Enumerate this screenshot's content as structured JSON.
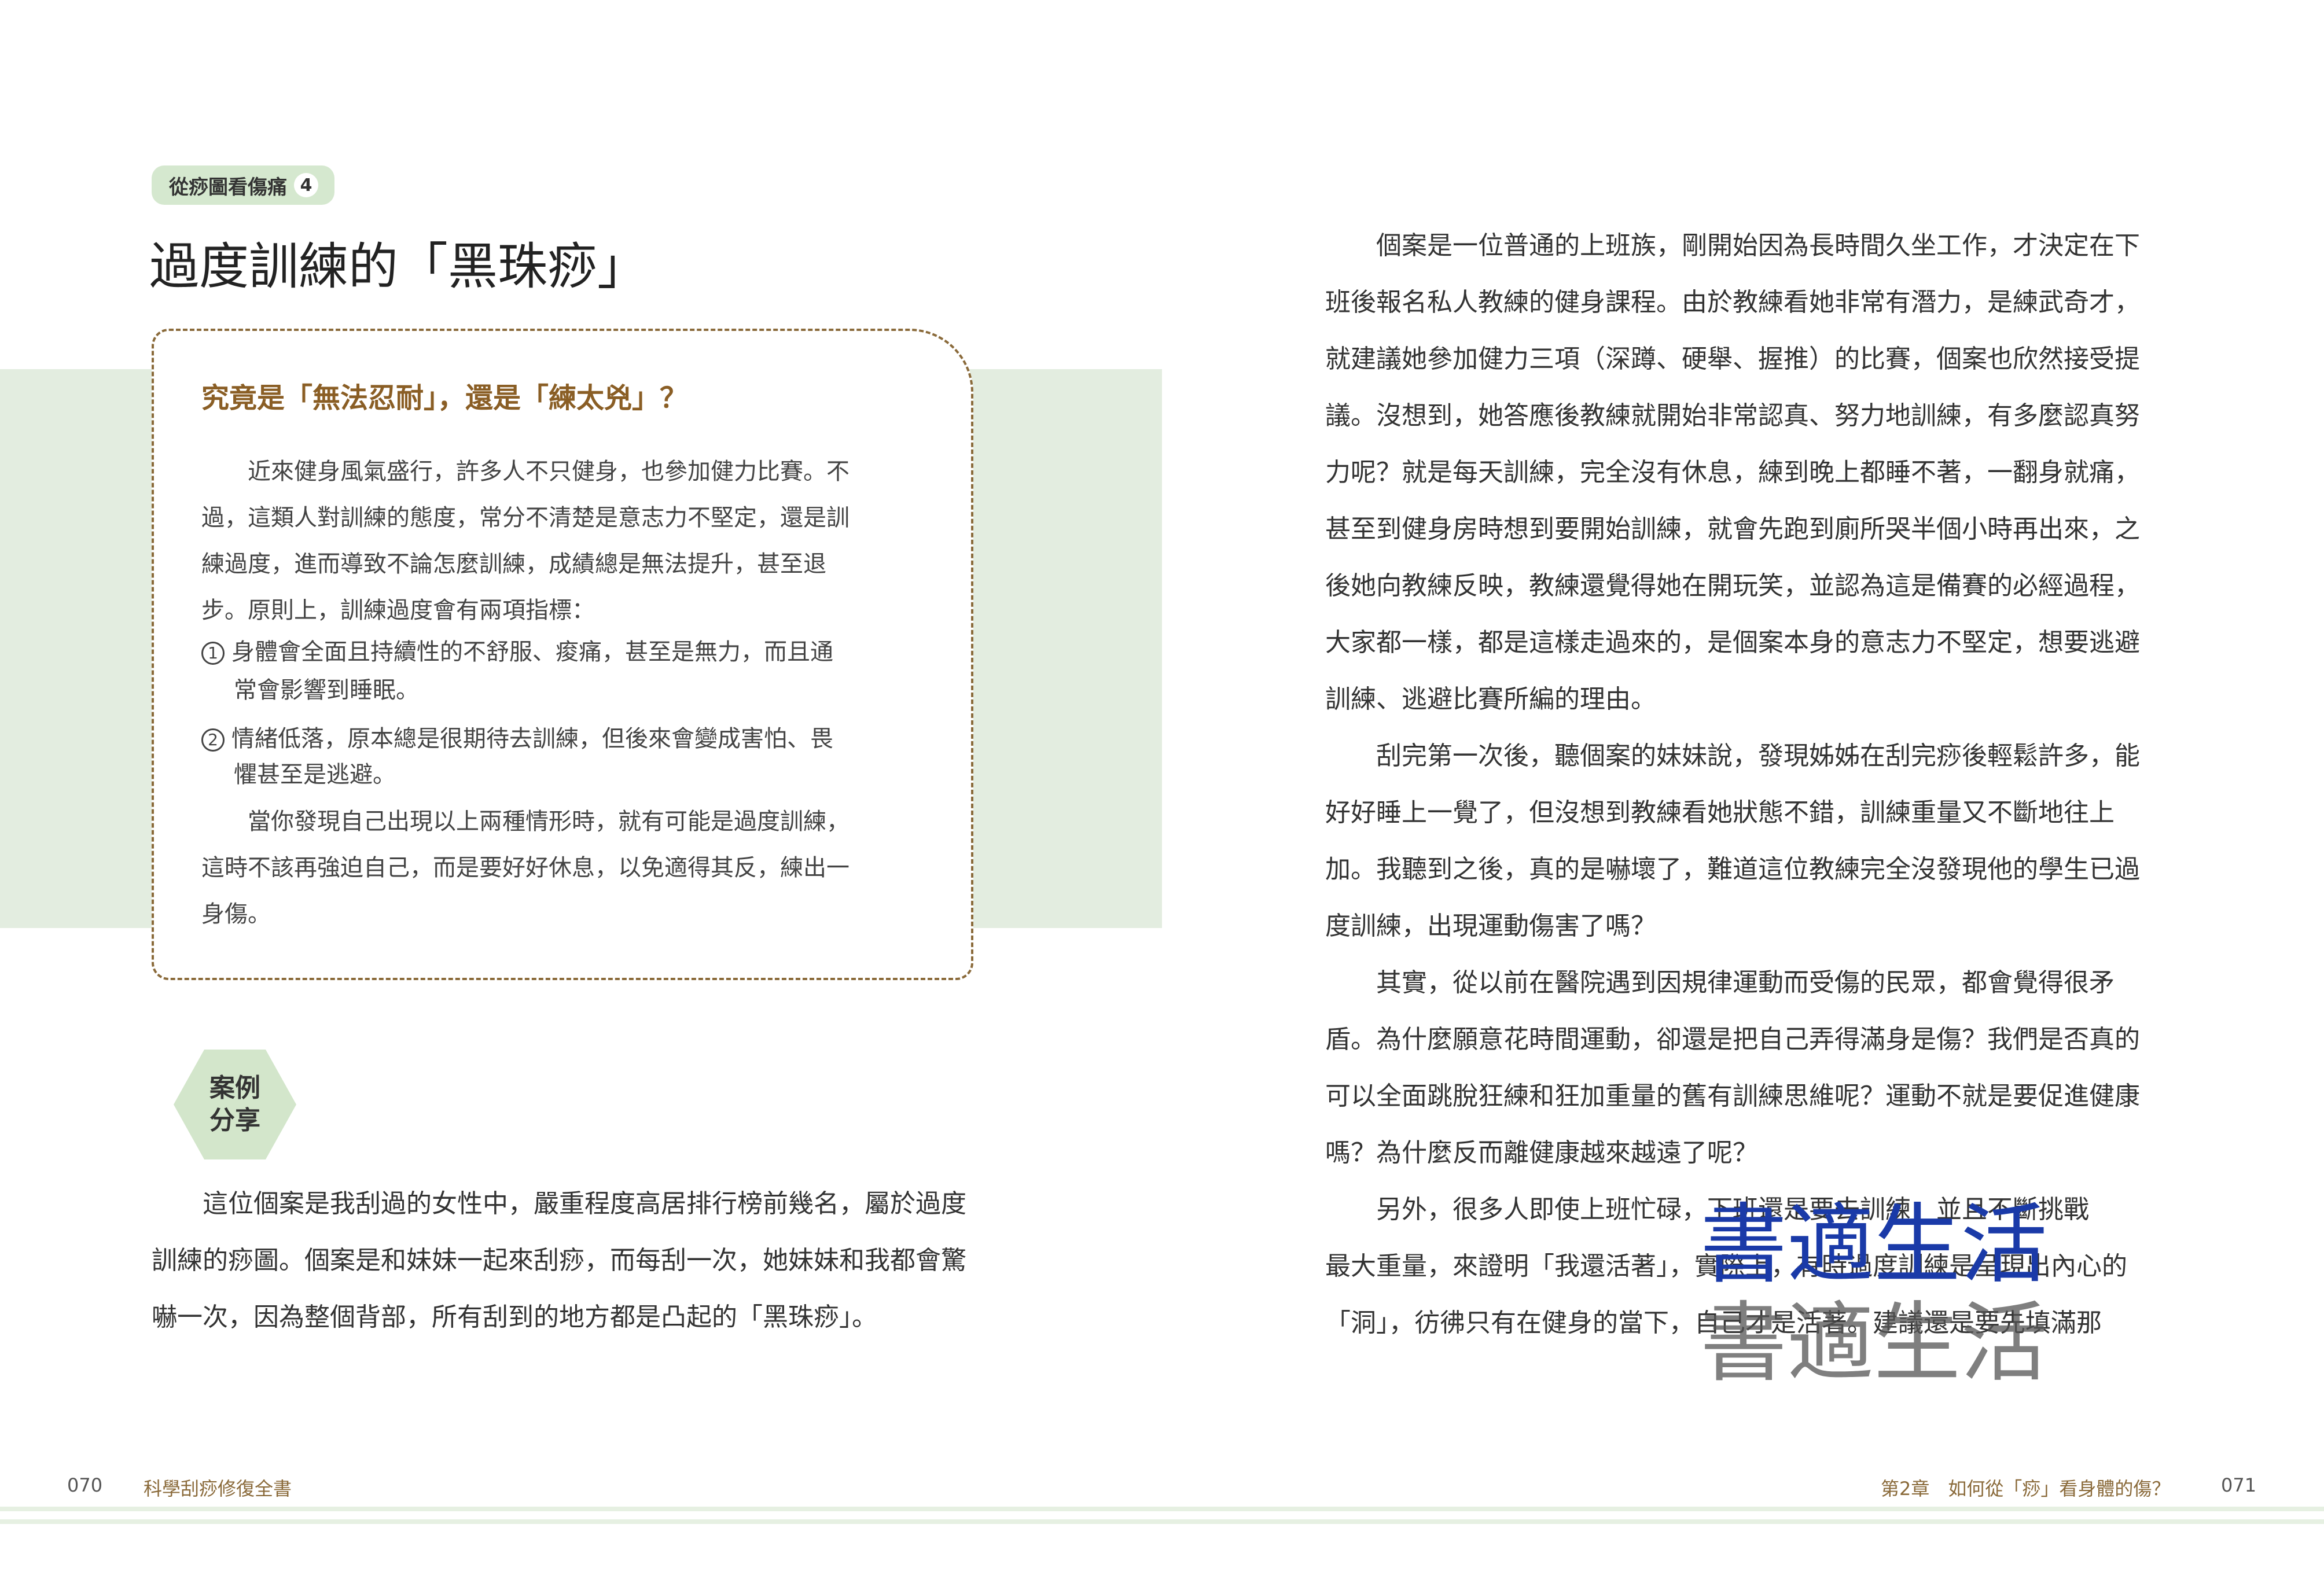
{
  "left_page": {
    "tag_text": "從痧圖看傷痛",
    "tag_number": "4",
    "title": "過度訓練的「黑珠痧」",
    "box": {
      "heading": "究竟是「無法忍耐」，還是「練太兇」？",
      "lines": [
        "　　近來健身風氣盛行，許多人不只健身，也參加健力比賽。不",
        "過，這類人對訓練的態度，常分不清楚是意志力不堅定，還是訓",
        "練過度，進而導致不論怎麼訓練，成績總是無法提升，甚至退",
        "步。原則上，訓練過度會有兩項指標："
      ],
      "item1_num": "1",
      "item1_line1": "身體會全面且持續性的不舒服、痠痛，甚至是無力，而且通",
      "item1_line2": "常會影響到睡眠。",
      "item2_num": "2",
      "item2_line1": "情緒低落，原本總是很期待去訓練，但後來會變成害怕、畏",
      "item2_line2": "懼甚至是逃避。",
      "closing_lines": [
        "　　當你發現自己出現以上兩種情形時，就有可能是過度訓練，",
        "這時不該再強迫自己，而是要好好休息，以免適得其反，練出一",
        "身傷。"
      ]
    },
    "case_label_line1": "案例",
    "case_label_line2": "分享",
    "case_lines": [
      "　　這位個案是我刮過的女性中，嚴重程度高居排行榜前幾名，屬於過度",
      "訓練的痧圖。個案是和妹妹一起來刮痧，而每刮一次，她妹妹和我都會驚",
      "嚇一次，因為整個背部，所有刮到的地方都是凸起的「黑珠痧」。"
    ]
  },
  "right_page": {
    "lines": [
      "　　個案是一位普通的上班族，剛開始因為長時間久坐工作，才決定在下",
      "班後報名私人教練的健身課程。由於教練看她非常有潛力，是練武奇才，",
      "就建議她參加健力三項（深蹲、硬舉、握推）的比賽，個案也欣然接受提",
      "議。沒想到，她答應後教練就開始非常認真、努力地訓練，有多麼認真努",
      "力呢？就是每天訓練，完全沒有休息，練到晚上都睡不著，一翻身就痛，",
      "甚至到健身房時想到要開始訓練，就會先跑到廁所哭半個小時再出來，之",
      "後她向教練反映，教練還覺得她在開玩笑，並認為這是備賽的必經過程，",
      "大家都一樣，都是這樣走過來的，是個案本身的意志力不堅定，想要逃避",
      "訓練、逃避比賽所編的理由。",
      "　　刮完第一次後，聽個案的妹妹說，發現姊姊在刮完痧後輕鬆許多，能",
      "好好睡上一覺了，但沒想到教練看她狀態不錯，訓練重量又不斷地往上",
      "加。我聽到之後，真的是嚇壞了，難道這位教練完全沒發現他的學生已過",
      "度訓練，出現運動傷害了嗎？",
      "　　其實，從以前在醫院遇到因規律運動而受傷的民眾，都會覺得很矛",
      "盾。為什麼願意花時間運動，卻還是把自己弄得滿身是傷？我們是否真的",
      "可以全面跳脫狂練和狂加重量的舊有訓練思維呢？運動不就是要促進健康",
      "嗎？為什麼反而離健康越來越遠了呢？",
      "　　另外，很多人即使上班忙碌，下班還是要去訓練，並且不斷挑戰",
      "最大重量，來證明「我還活著」，實際上，有時過度訓練是呈現出內心的",
      "「洞」，彷彿只有在健身的當下，自己才是活著。建議還是要先填滿那"
    ]
  },
  "footer": {
    "left_page_number": "070",
    "left_book_title": "科學刮痧修復全書",
    "right_chapter": "第2章　如何從「痧」看身體的傷？",
    "right_page_number": "071"
  },
  "watermark": {
    "line1": "書適生活",
    "line2": "書適生活"
  },
  "colors": {
    "band_green": "#e3ede0",
    "tag_green": "#d5e8cf",
    "accent_brown": "#8a5e25",
    "watermark_blue": "#1a3aa8"
  }
}
